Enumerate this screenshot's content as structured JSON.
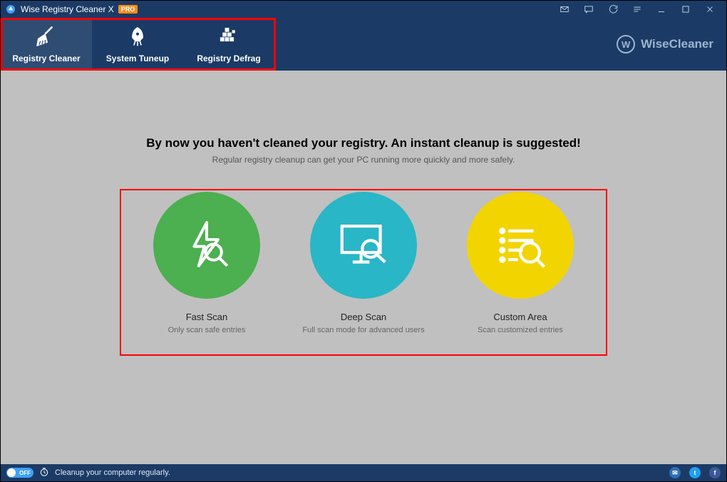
{
  "window": {
    "title": "Wise Registry Cleaner X",
    "pro_badge": "PRO"
  },
  "brand": {
    "name": "WiseCleaner",
    "logo_letter": "W"
  },
  "tabs": [
    {
      "label": "Registry Cleaner"
    },
    {
      "label": "System Tuneup"
    },
    {
      "label": "Registry Defrag"
    }
  ],
  "main": {
    "headline": "By now you haven't cleaned your registry. An instant cleanup is suggested!",
    "subline": "Regular registry cleanup can get your PC running more quickly and more safely."
  },
  "scans": [
    {
      "title": "Fast Scan",
      "desc": "Only scan safe entries",
      "color": "green"
    },
    {
      "title": "Deep Scan",
      "desc": "Full scan mode for advanced users",
      "color": "teal"
    },
    {
      "title": "Custom Area",
      "desc": "Scan customized entries",
      "color": "yellow"
    }
  ],
  "footer": {
    "toggle_label": "OFF",
    "message": "Cleanup your computer regularly."
  }
}
